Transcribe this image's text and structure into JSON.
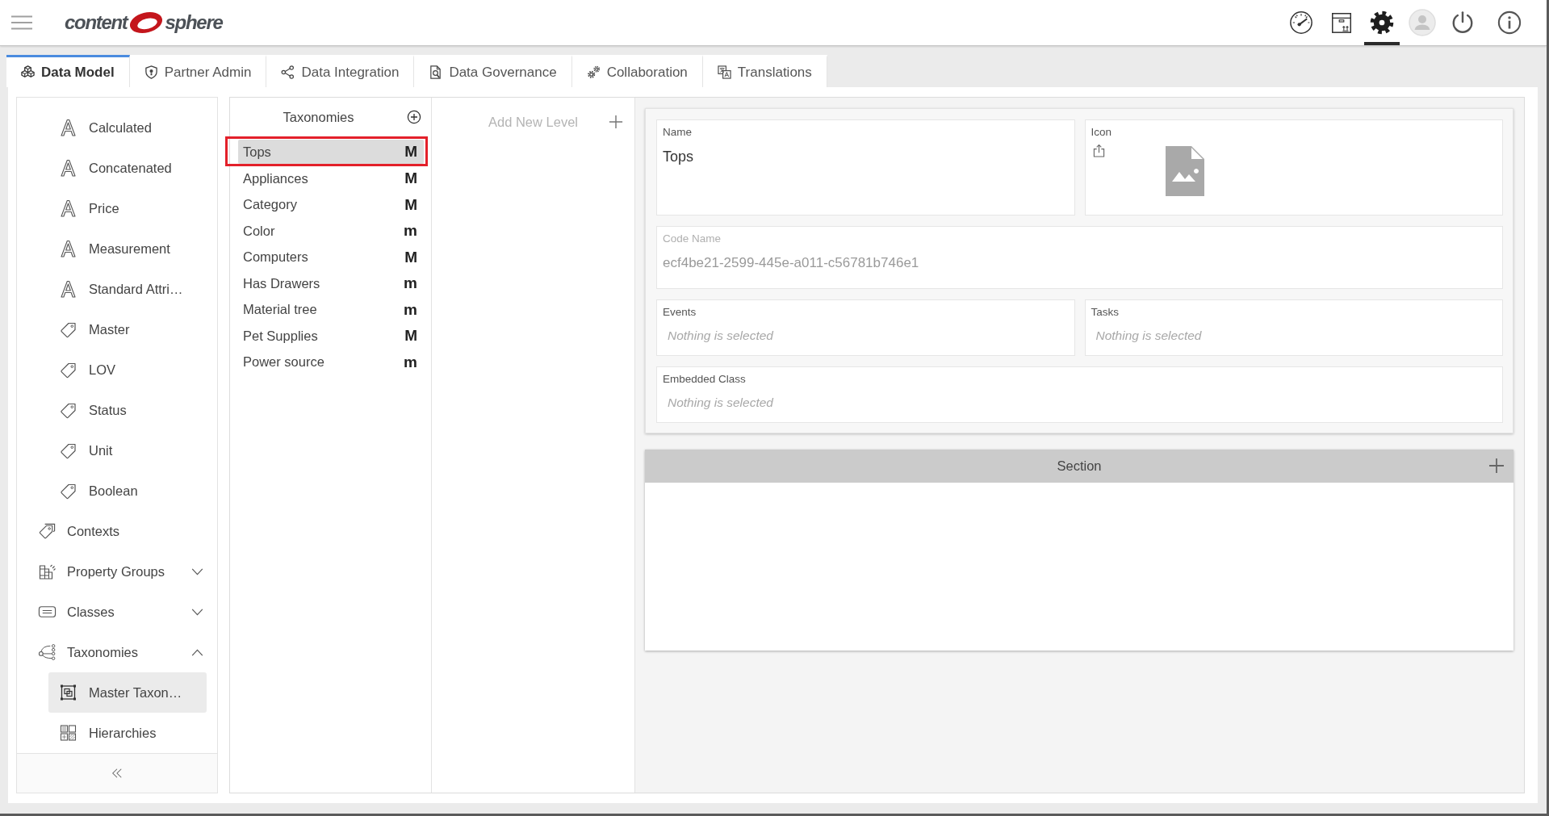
{
  "header": {
    "logo": {
      "left_text": "content",
      "right_text": "sphere"
    },
    "toolbar": [
      {
        "kind": "dashboard",
        "selected": false
      },
      {
        "kind": "package",
        "selected": false
      },
      {
        "kind": "settings",
        "selected": true
      },
      {
        "kind": "account",
        "selected": false
      },
      {
        "kind": "power",
        "selected": false
      },
      {
        "kind": "info",
        "selected": false
      }
    ]
  },
  "tabs": [
    {
      "label": "Data Model",
      "kind": "data-model",
      "selected": true
    },
    {
      "label": "Partner Admin",
      "kind": "partner-admin",
      "selected": false
    },
    {
      "label": "Data Integration",
      "kind": "data-integration",
      "selected": false
    },
    {
      "label": "Data Governance",
      "kind": "data-governance",
      "selected": false
    },
    {
      "label": "Collaboration",
      "kind": "collaboration",
      "selected": false
    },
    {
      "label": "Translations",
      "kind": "translations",
      "selected": false
    }
  ],
  "sidebar": {
    "items": [
      {
        "children": [
          {
            "label": "Calculated",
            "kind": "attribute",
            "selected": false
          },
          {
            "label": "Concatenated",
            "kind": "attribute",
            "selected": false
          },
          {
            "label": "Price",
            "kind": "attribute",
            "selected": false
          },
          {
            "label": "Measurement",
            "kind": "attribute",
            "selected": false
          },
          {
            "label": "Standard Attri…",
            "kind": "attribute",
            "selected": false
          },
          {
            "label": "Master",
            "kind": "tag",
            "selected": false
          },
          {
            "label": "LOV",
            "kind": "tag",
            "selected": false
          },
          {
            "label": "Status",
            "kind": "tag",
            "selected": false
          },
          {
            "label": "Unit",
            "kind": "tag",
            "selected": false
          },
          {
            "label": "Boolean",
            "kind": "tag",
            "selected": false
          }
        ]
      },
      {
        "label": "Contexts",
        "kind": "tags",
        "selected": false
      },
      {
        "label": "Property Groups",
        "kind": "property-groups",
        "selected": false,
        "expanded": false
      },
      {
        "label": "Classes",
        "kind": "classes",
        "selected": false,
        "expanded": false
      },
      {
        "label": "Taxonomies",
        "kind": "taxonomies",
        "selected": false,
        "expanded": true,
        "children": [
          {
            "label": "Master Taxon…",
            "kind": "master-taxonomy",
            "selected": true
          },
          {
            "label": "Hierarchies",
            "kind": "hierarchies",
            "selected": false
          }
        ]
      }
    ]
  },
  "taxonomy_list": {
    "title": "Taxonomies",
    "items": [
      {
        "name": "Tops",
        "badge": "M",
        "selected": true,
        "highlighted": true
      },
      {
        "name": "Appliances",
        "badge": "M",
        "selected": false,
        "highlighted": false
      },
      {
        "name": "Category",
        "badge": "M",
        "selected": false,
        "highlighted": false
      },
      {
        "name": "Color",
        "badge": "m",
        "selected": false,
        "highlighted": false
      },
      {
        "name": "Computers",
        "badge": "M",
        "selected": false,
        "highlighted": false
      },
      {
        "name": "Has Drawers",
        "badge": "m",
        "selected": false,
        "highlighted": false
      },
      {
        "name": "Material tree",
        "badge": "m",
        "selected": false,
        "highlighted": false
      },
      {
        "name": "Pet Supplies",
        "badge": "M",
        "selected": false,
        "highlighted": false
      },
      {
        "name": "Power source",
        "badge": "m",
        "selected": false,
        "highlighted": false
      }
    ]
  },
  "levels": {
    "placeholder": "Add New Level"
  },
  "details": {
    "name": {
      "label": "Name",
      "value": "Tops",
      "disabled": false
    },
    "icon": {
      "label": "Icon"
    },
    "code_name": {
      "label": "Code Name",
      "value": "ecf4be21-2599-445e-a011-c56781b746e1",
      "disabled": true
    },
    "events": {
      "label": "Events",
      "placeholder": "Nothing is selected"
    },
    "tasks": {
      "label": "Tasks",
      "placeholder": "Nothing is selected"
    },
    "embedded_class": {
      "label": "Embedded Class",
      "placeholder": "Nothing is selected"
    }
  },
  "section": {
    "title": "Section"
  }
}
